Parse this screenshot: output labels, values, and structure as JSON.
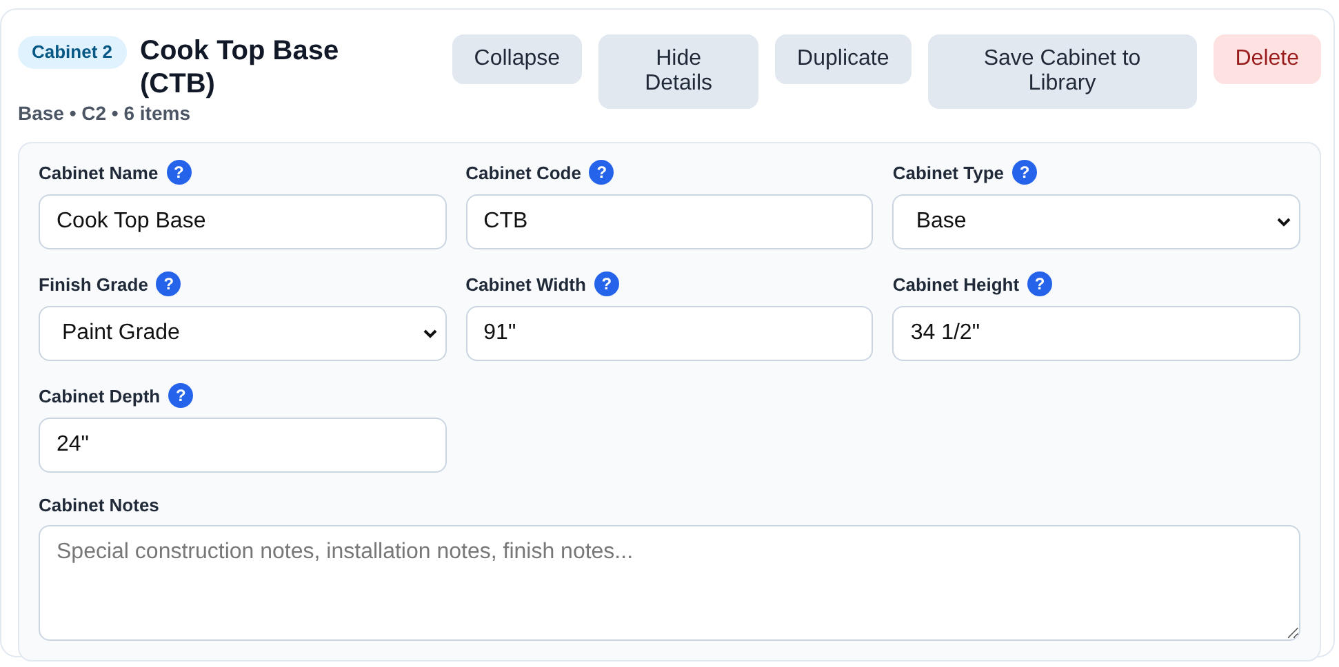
{
  "header": {
    "badge": "Cabinet 2",
    "title": "Cook Top Base (CTB)",
    "subtitle": "Base • C2 • 6 items"
  },
  "buttons": [
    {
      "label": "Collapse",
      "kind": "neutral"
    },
    {
      "label": "Hide Details",
      "kind": "neutral"
    },
    {
      "label": "Duplicate",
      "kind": "neutral"
    },
    {
      "label": "Save Cabinet to Library",
      "kind": "neutral"
    },
    {
      "label": "Delete",
      "kind": "danger"
    }
  ],
  "fields": [
    {
      "label": "Cabinet Name",
      "help": "?",
      "kind": "input",
      "value": "Cook Top Base"
    },
    {
      "label": "Cabinet Code",
      "help": "?",
      "kind": "input",
      "value": "CTB"
    },
    {
      "label": "Cabinet Type",
      "help": "?",
      "kind": "select",
      "value": "Base"
    },
    {
      "label": "Finish Grade",
      "help": "?",
      "kind": "select",
      "value": "Paint Grade"
    },
    {
      "label": "Cabinet Width",
      "help": "?",
      "kind": "input",
      "value": "91\""
    },
    {
      "label": "Cabinet Height",
      "help": "?",
      "kind": "input",
      "value": "34 1/2\""
    },
    {
      "label": "Cabinet Depth",
      "help": "?",
      "kind": "input",
      "value": "24\""
    }
  ],
  "notes": {
    "label": "Cabinet Notes",
    "placeholder": "Special construction notes, installation notes, finish notes..."
  }
}
